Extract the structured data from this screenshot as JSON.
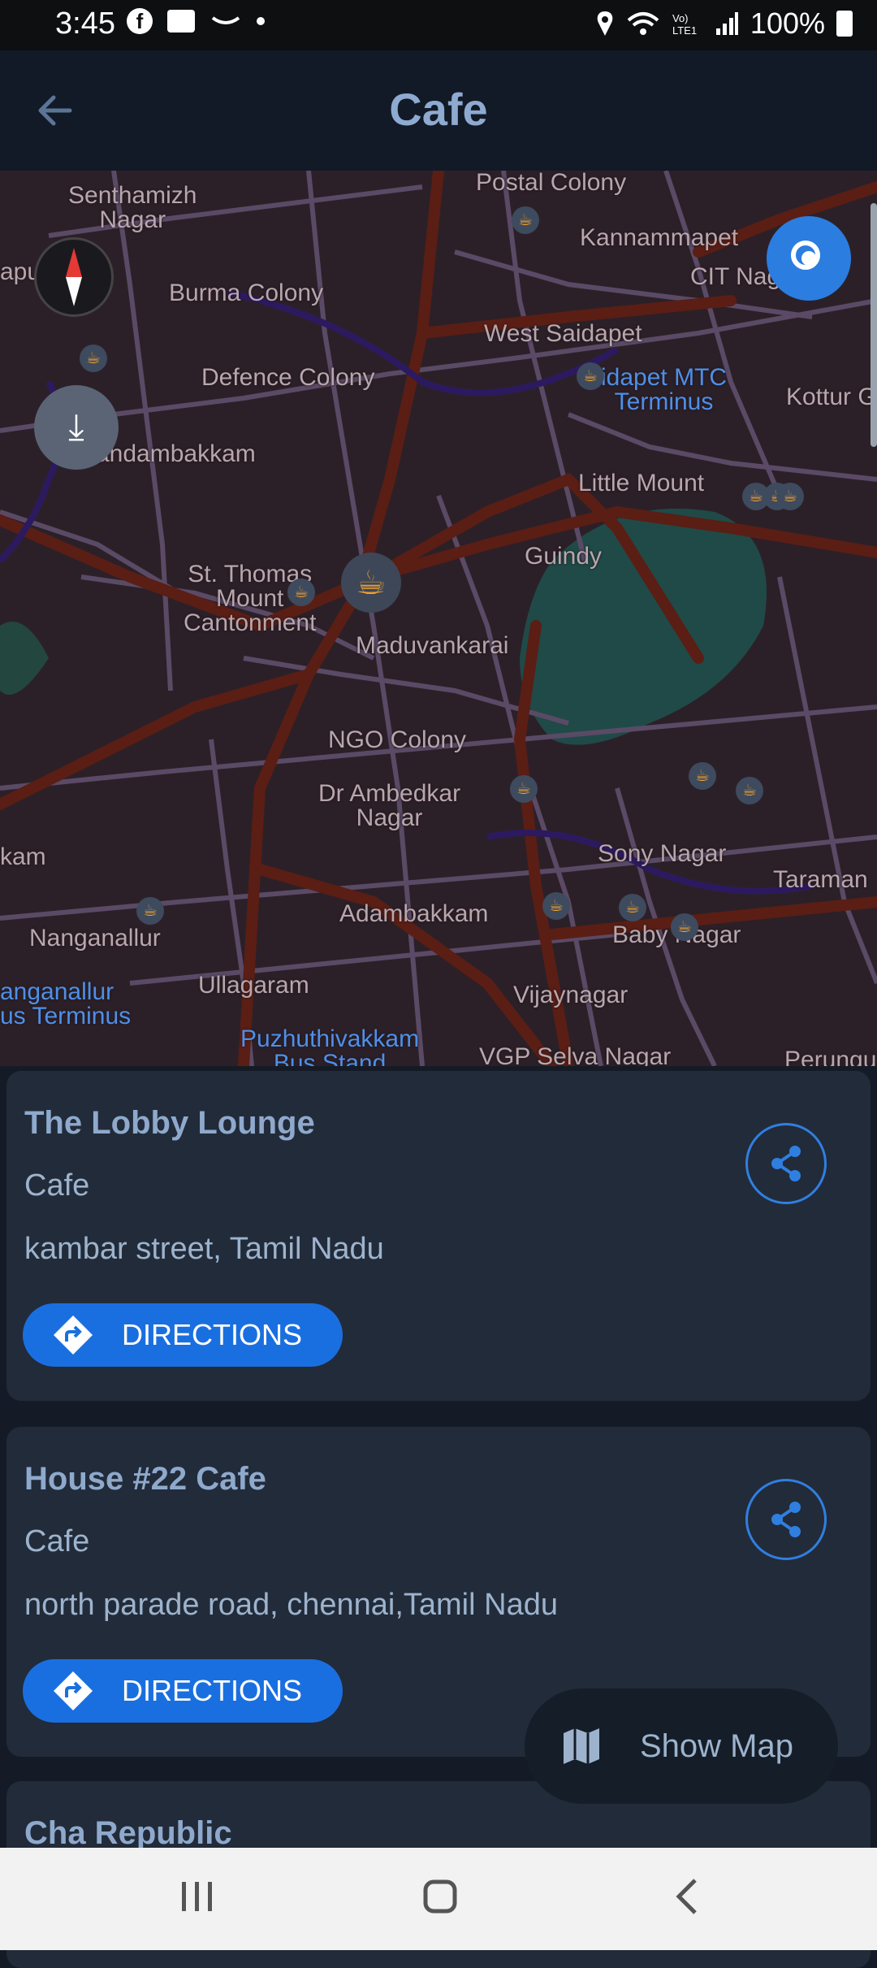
{
  "status_bar": {
    "time": "3:45",
    "battery": "100%",
    "icons": [
      "facebook-icon",
      "message-icon",
      "amazon-icon",
      "location-icon",
      "wifi-icon",
      "volte-icon",
      "signal-icon",
      "battery-icon"
    ]
  },
  "app_bar": {
    "title": "Cafe"
  },
  "map": {
    "labels": {
      "senthamizh": "Senthamizh\nNagar",
      "postal_colony": "Postal Colony",
      "kannammapet": "Kannammapet",
      "cit_nagar": "CIT Nag",
      "apuram": "apuram",
      "burma_colony": "Burma Colony",
      "west_saidapet": "West Saidapet",
      "defence_colony": "Defence Colony",
      "saidapet_mtc": "idapet MTC\nTerminus",
      "kottur": "Kottur G",
      "nandambakkam": "andambakkam",
      "little_mount": "Little Mount",
      "st_thomas": "St. Thomas\nMount\nCantonment",
      "guindy": "Guindy",
      "maduvankarai": "Maduvankarai",
      "ngo_colony": "NGO Colony",
      "ambedkar_nagar": "Dr Ambedkar\nNagar",
      "kam": "kam",
      "sony_nagar": "Sony Nagar",
      "taraman": "Taraman",
      "nanganallur": "Nanganallur",
      "adambakkam": "Adambakkam",
      "baby_nagar": "Baby Nagar",
      "nanganallur_bus": "anganallur\nus Terminus",
      "ullagaram": "Ullagaram",
      "vijaynagar": "Vijaynagar",
      "puzhuthivakkam": "Puzhuthivakkam\nBus Stand",
      "vgp_selva": "VGP Selva Nagar",
      "perungu": "Perungu"
    }
  },
  "places": [
    {
      "name": "The Lobby Lounge",
      "category": "Cafe",
      "address": "kambar street, Tamil Nadu",
      "directions_label": "DIRECTIONS"
    },
    {
      "name": "House #22 Cafe",
      "category": "Cafe",
      "address": "north parade road, chennai,Tamil Nadu",
      "directions_label": "DIRECTIONS"
    },
    {
      "name": "Cha Republic"
    }
  ],
  "show_map_label": "Show Map",
  "colors": {
    "accent": "#1a6fe0",
    "card_bg": "#222b39",
    "title_text": "#8eaad0",
    "map_road": "#5a1e14"
  }
}
